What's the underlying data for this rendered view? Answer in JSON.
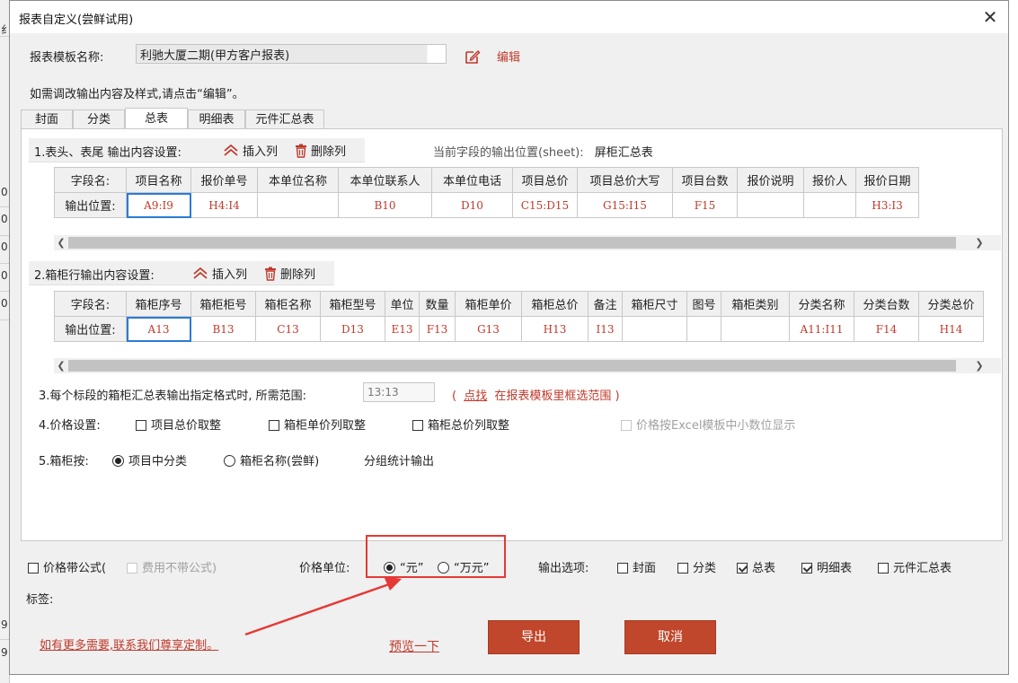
{
  "window": {
    "title": "报表自定义(尝鲜试用)"
  },
  "background_glyphs": [
    "纟",
    "0",
    "0",
    "0",
    "0",
    "0",
    "9",
    "9"
  ],
  "template": {
    "label": "报表模板名称:",
    "value": "利驰大厦二期(甲方客户报表)",
    "edit_label": "编辑"
  },
  "hint": "如需调改输出内容及样式,请点击“编辑”。",
  "tabs": [
    {
      "label": "封面"
    },
    {
      "label": "分类"
    },
    {
      "label": "总表",
      "active": true
    },
    {
      "label": "明细表"
    },
    {
      "label": "元件汇总表"
    }
  ],
  "section1": {
    "title": "1.表头、表尾 输出内容设置:",
    "insert_label": "插入列",
    "delete_label": "删除列",
    "sheet_prefix": "当前字段的输出位置(sheet):",
    "sheet_name": "屏柜汇总表",
    "field_label": "字段名:",
    "pos_label": "输出位置:",
    "columns": [
      "项目名称",
      "报价单号",
      "本单位名称",
      "本单位联系人",
      "本单位电话",
      "项目总价",
      "项目总价大写",
      "项目台数",
      "报价说明",
      "报价人",
      "报价日期"
    ],
    "values": [
      "A9:I9",
      "H4:I4",
      "",
      "B10",
      "D10",
      "C15:D15",
      "G15:I15",
      "F15",
      "",
      "",
      "H3:I3"
    ]
  },
  "section2": {
    "title": "2.箱柜行输出内容设置:",
    "insert_label": "插入列",
    "delete_label": "删除列",
    "field_label": "字段名:",
    "pos_label": "输出位置:",
    "columns": [
      "箱柜序号",
      "箱柜柜号",
      "箱柜名称",
      "箱柜型号",
      "单位",
      "数量",
      "箱柜单价",
      "箱柜总价",
      "备注",
      "箱柜尺寸",
      "图号",
      "箱柜类别",
      "分类名称",
      "分类台数",
      "分类总价"
    ],
    "values": [
      "A13",
      "B13",
      "C13",
      "D13",
      "E13",
      "F13",
      "G13",
      "H13",
      "I13",
      "",
      "",
      "",
      "A11:I11",
      "F14",
      "H14"
    ]
  },
  "section3": {
    "label": "3.每个标段的箱柜汇总表输出指定格式时, 所需范围:",
    "range_value": "13:13",
    "paren_open": "(",
    "pick_link": "点找",
    "pick_hint": "在报表模板里框选范围",
    "paren_close": ")"
  },
  "section4": {
    "label": "4.价格设置:",
    "options": [
      {
        "label": "项目总价取整",
        "checked": false
      },
      {
        "label": "箱柜单价列取整",
        "checked": false
      },
      {
        "label": "箱柜总价列取整",
        "checked": false
      }
    ],
    "excel_decimal_label": "价格按Excel模板中小数位显示"
  },
  "section5": {
    "label": "5.箱柜按:",
    "opt1": "项目中分类",
    "opt2": "箱柜名称(尝鲜)",
    "suffix": "分组统计输出"
  },
  "bottom": {
    "price_formula_label": "价格带公式(",
    "fee_no_formula_label": "费用不带公式)",
    "price_unit_label": "价格单位:",
    "unit_yuan": "“元”",
    "unit_wanyuan": "“万元”",
    "output_options_label": "输出选项:",
    "output_options": [
      {
        "label": "封面",
        "checked": false
      },
      {
        "label": "分类",
        "checked": false
      },
      {
        "label": "总表",
        "checked": true
      },
      {
        "label": "明细表",
        "checked": true
      },
      {
        "label": "元件汇总表",
        "checked": false
      }
    ],
    "tag_label": "标签:",
    "contact_link": "如有更多需要,联系我们尊享定制。",
    "preview_link": "预览一下",
    "export_label": "导出",
    "cancel_label": "取消"
  },
  "colors": {
    "accent_red": "#c0472b",
    "highlight_red": "#e53935",
    "value_red": "#c0392b",
    "selection_blue": "#2a7bd5"
  }
}
